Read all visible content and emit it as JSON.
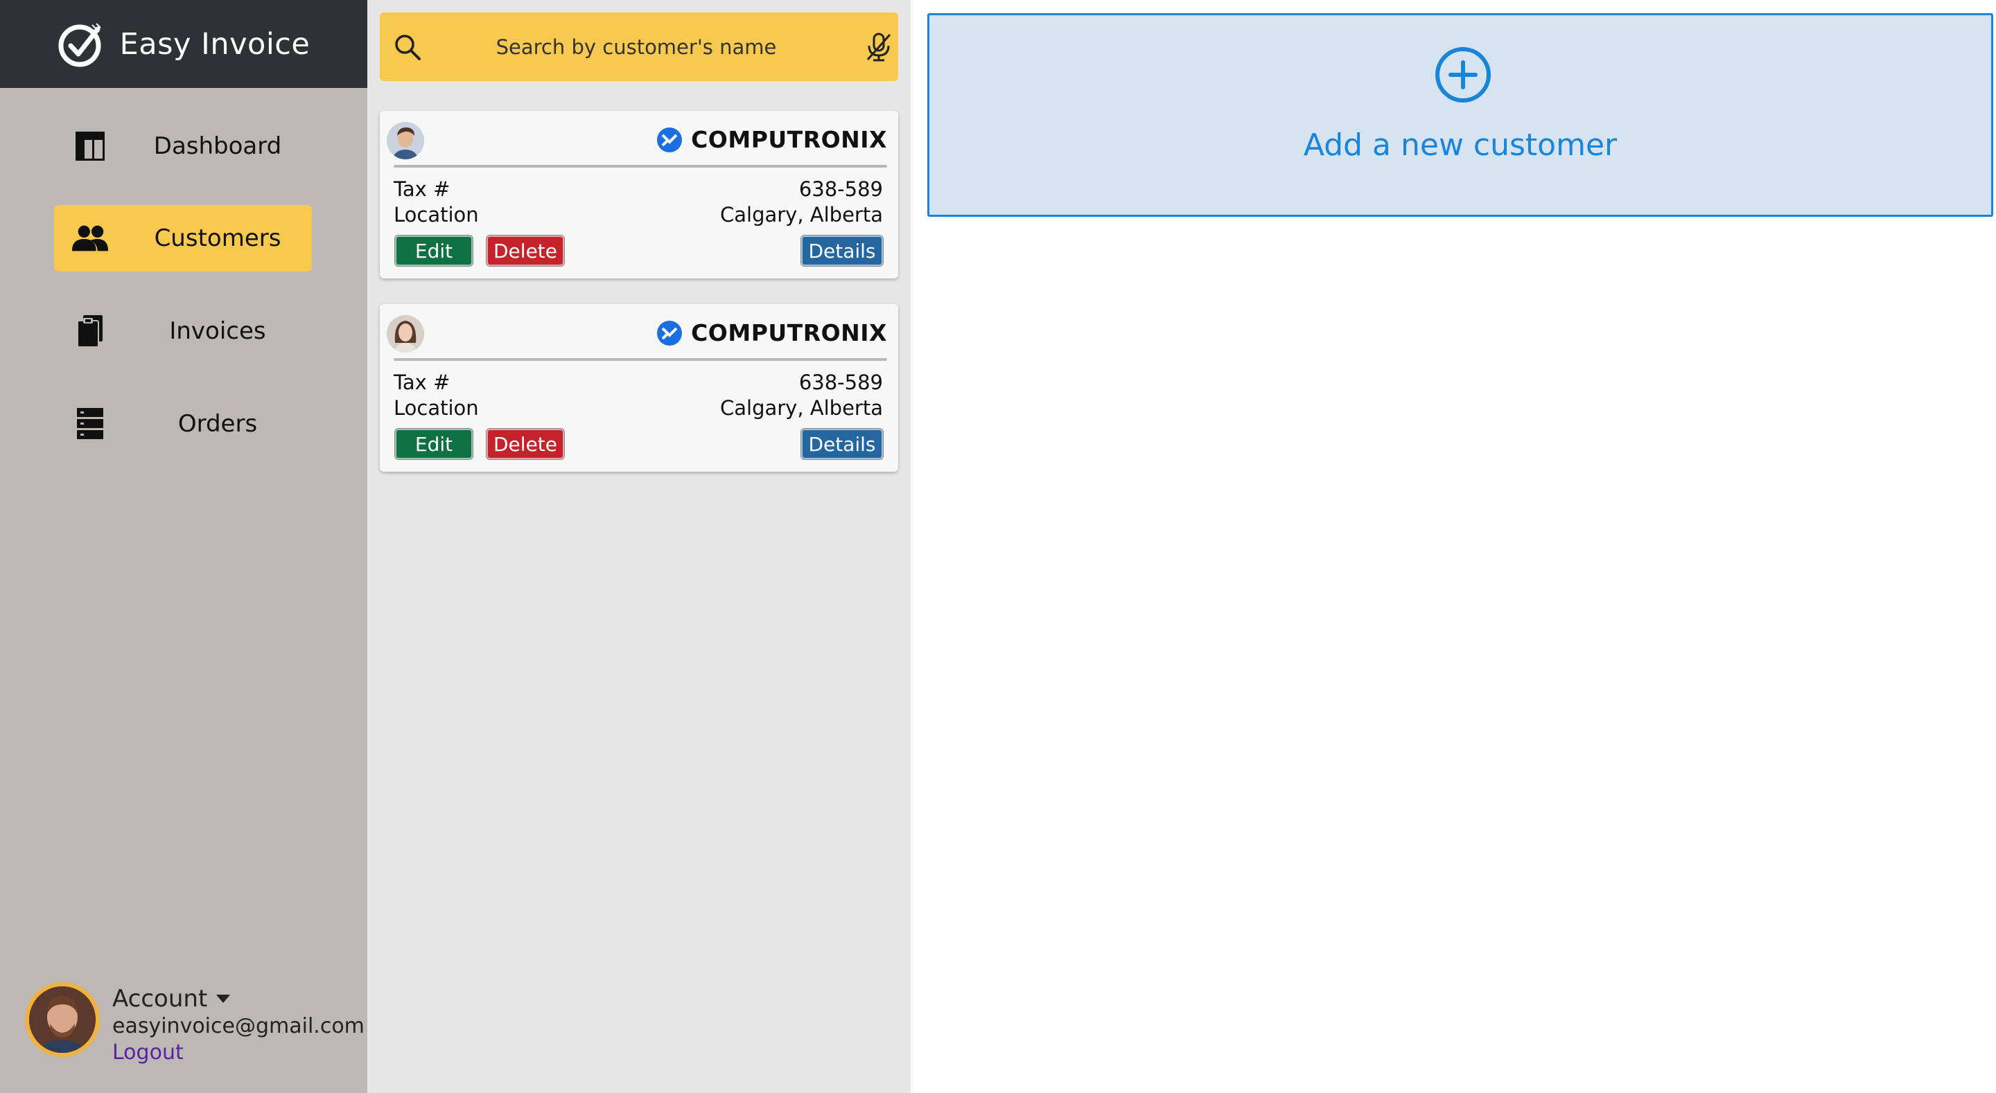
{
  "brand": {
    "name": "Easy Invoice",
    "logo_icon": "checkmark-circle-icon"
  },
  "sidebar": {
    "items": [
      {
        "label": "Dashboard",
        "icon": "dashboard-icon",
        "active": false
      },
      {
        "label": "Customers",
        "icon": "users-icon",
        "active": true
      },
      {
        "label": "Invoices",
        "icon": "clipboard-icon",
        "active": false
      },
      {
        "label": "Orders",
        "icon": "server-list-icon",
        "active": false
      }
    ]
  },
  "account": {
    "title": "Account",
    "email": "easyinvoice@gmail.com",
    "logout_label": "Logout"
  },
  "search": {
    "placeholder": "Search by customer's name",
    "value": ""
  },
  "customers": [
    {
      "company": "COMPUTRONIX",
      "tax_label": "Tax #",
      "tax_value": "638-589",
      "location_label": "Location",
      "location_value": "Calgary, Alberta",
      "edit_label": "Edit",
      "delete_label": "Delete",
      "details_label": "Details"
    },
    {
      "company": "COMPUTRONIX",
      "tax_label": "Tax #",
      "tax_value": "638-589",
      "location_label": "Location",
      "location_value": "Calgary, Alberta",
      "edit_label": "Edit",
      "delete_label": "Delete",
      "details_label": "Details"
    }
  ],
  "main": {
    "add_customer_label": "Add a new customer"
  },
  "colors": {
    "accent_yellow": "#f7c94f",
    "sidebar_bg": "#bcb8b4",
    "brand_bg": "#2f3234",
    "edit_green": "#0f7043",
    "delete_red": "#c4232b",
    "details_blue": "#2466a0",
    "link_blue": "#1a84d8",
    "logout_purple": "#5b1fa8"
  }
}
